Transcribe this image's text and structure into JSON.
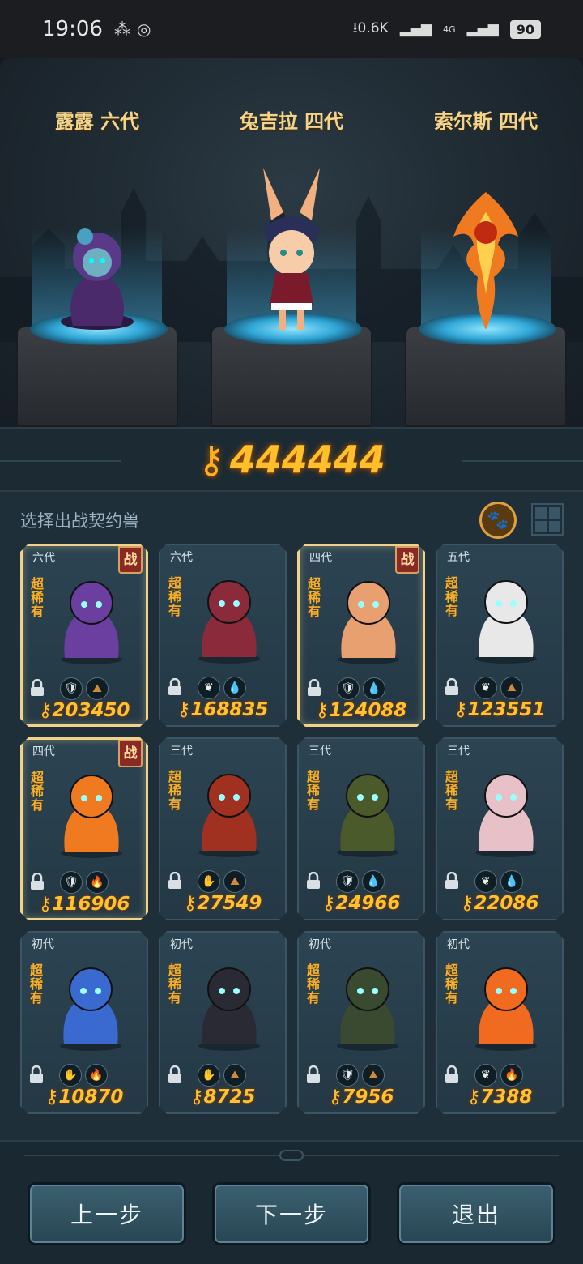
{
  "status_bar": {
    "time": "19:06",
    "net_speed": "⭳0.6K",
    "network": "4G",
    "battery": "90"
  },
  "featured": [
    {
      "name": "露露 六代",
      "color": "#7b4bb0"
    },
    {
      "name": "兔吉拉 四代",
      "color": "#f0a868"
    },
    {
      "name": "索尔斯 四代",
      "color": "#f07a20"
    }
  ],
  "currency": {
    "icon": "key-icon",
    "amount": "444444"
  },
  "panel": {
    "title": "选择出战契约兽",
    "paw_icon": "paw-icon",
    "grid_icon": "grid-view-icon"
  },
  "cards": [
    {
      "gen": "六代",
      "rarity": "超稀有",
      "battle": "战",
      "selected": true,
      "power": "203450",
      "elements": [
        "shield",
        "earth"
      ],
      "color": "#6a3fa0"
    },
    {
      "gen": "六代",
      "rarity": "超稀有",
      "battle": "",
      "selected": false,
      "power": "168835",
      "elements": [
        "leaf",
        "water"
      ],
      "color": "#8a2a3a"
    },
    {
      "gen": "四代",
      "rarity": "超稀有",
      "battle": "战",
      "selected": true,
      "power": "124088",
      "elements": [
        "shield",
        "water"
      ],
      "color": "#e8a070"
    },
    {
      "gen": "五代",
      "rarity": "超稀有",
      "battle": "",
      "selected": false,
      "power": "123551",
      "elements": [
        "leaf",
        "earth"
      ],
      "color": "#e8e8e8"
    },
    {
      "gen": "四代",
      "rarity": "超稀有",
      "battle": "战",
      "selected": true,
      "power": "116906",
      "elements": [
        "shield",
        "fire"
      ],
      "color": "#f07a20"
    },
    {
      "gen": "三代",
      "rarity": "超稀有",
      "battle": "",
      "selected": false,
      "power": "27549",
      "elements": [
        "claw",
        "earth"
      ],
      "color": "#a03020"
    },
    {
      "gen": "三代",
      "rarity": "超稀有",
      "battle": "",
      "selected": false,
      "power": "24966",
      "elements": [
        "shield",
        "water"
      ],
      "color": "#4a5a2a"
    },
    {
      "gen": "三代",
      "rarity": "超稀有",
      "battle": "",
      "selected": false,
      "power": "22086",
      "elements": [
        "leaf",
        "water"
      ],
      "color": "#e8c0c8"
    },
    {
      "gen": "初代",
      "rarity": "超稀有",
      "battle": "",
      "selected": false,
      "power": "10870",
      "elements": [
        "claw",
        "fire"
      ],
      "color": "#3a6ad0"
    },
    {
      "gen": "初代",
      "rarity": "超稀有",
      "battle": "",
      "selected": false,
      "power": "8725",
      "elements": [
        "claw",
        "earth"
      ],
      "color": "#2a2a35"
    },
    {
      "gen": "初代",
      "rarity": "超稀有",
      "battle": "",
      "selected": false,
      "power": "7956",
      "elements": [
        "shield",
        "earth"
      ],
      "color": "#3a4a30"
    },
    {
      "gen": "初代",
      "rarity": "超稀有",
      "battle": "",
      "selected": false,
      "power": "7388",
      "elements": [
        "leaf",
        "fire"
      ],
      "color": "#f06a20"
    }
  ],
  "buttons": {
    "prev": "上一步",
    "next": "下一步",
    "exit": "退出"
  }
}
